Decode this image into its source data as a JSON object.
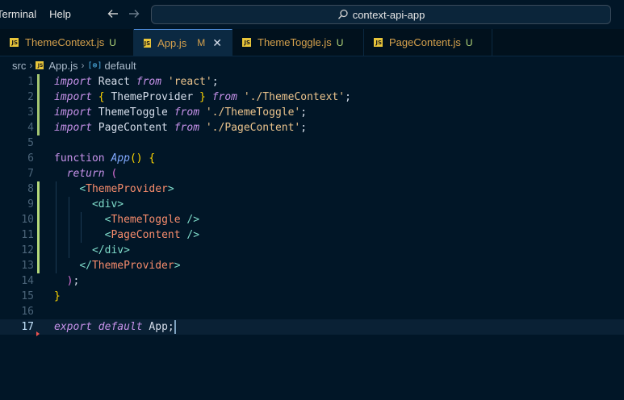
{
  "menu": {
    "terminal": "Terminal",
    "help": "Help"
  },
  "search": {
    "placeholder": "context-api-app"
  },
  "tabs": [
    {
      "name": "ThemeContext.js",
      "status": "U"
    },
    {
      "name": "App.js",
      "status": "M"
    },
    {
      "name": "ThemeToggle.js",
      "status": "U"
    },
    {
      "name": "PageContent.js",
      "status": "U"
    }
  ],
  "breadcrumb": {
    "folder": "src",
    "file": "App.js",
    "symbol": "default"
  },
  "icons": {
    "back": "arrow-left-icon",
    "forward": "arrow-right-icon",
    "search": "search-icon",
    "close": "close-icon",
    "js_file": "js-file-icon",
    "symbol": "symbol-variable-icon"
  },
  "colors": {
    "background": "#011627",
    "tab_active_bg": "#0b2942",
    "untracked": "#b5d97b",
    "modified": "#d4a04c",
    "keyword": "#c792ea",
    "string": "#ecc48d",
    "function": "#82aaff",
    "tag": "#7fdbca",
    "component": "#f78c6c"
  },
  "editor": {
    "active_line": 17,
    "lines": [
      {
        "n": "1",
        "marker": "mod",
        "indent": 0,
        "tokens": [
          [
            "kw",
            "import"
          ],
          [
            "plain",
            " React "
          ],
          [
            "kw",
            "from"
          ],
          [
            "plain",
            " "
          ],
          [
            "str",
            "'react'"
          ],
          [
            "plain",
            ";"
          ]
        ]
      },
      {
        "n": "2",
        "marker": "mod",
        "indent": 0,
        "tokens": [
          [
            "kw",
            "import"
          ],
          [
            "plain",
            " "
          ],
          [
            "pn",
            "{"
          ],
          [
            "plain",
            " ThemeProvider "
          ],
          [
            "pn",
            "}"
          ],
          [
            "plain",
            " "
          ],
          [
            "kw",
            "from"
          ],
          [
            "plain",
            " "
          ],
          [
            "str",
            "'./ThemeContext'"
          ],
          [
            "plain",
            ";"
          ]
        ]
      },
      {
        "n": "3",
        "marker": "mod",
        "indent": 0,
        "tokens": [
          [
            "kw",
            "import"
          ],
          [
            "plain",
            " ThemeToggle "
          ],
          [
            "kw",
            "from"
          ],
          [
            "plain",
            " "
          ],
          [
            "str",
            "'./ThemeToggle'"
          ],
          [
            "plain",
            ";"
          ]
        ]
      },
      {
        "n": "4",
        "marker": "mod",
        "indent": 0,
        "tokens": [
          [
            "kw",
            "import"
          ],
          [
            "plain",
            " PageContent "
          ],
          [
            "kw",
            "from"
          ],
          [
            "plain",
            " "
          ],
          [
            "str",
            "'./PageContent'"
          ],
          [
            "plain",
            ";"
          ]
        ]
      },
      {
        "n": "5",
        "marker": "",
        "indent": 0,
        "tokens": []
      },
      {
        "n": "6",
        "marker": "",
        "indent": 0,
        "tokens": [
          [
            "kwn",
            "function"
          ],
          [
            "plain",
            " "
          ],
          [
            "fn",
            "App"
          ],
          [
            "pn",
            "()"
          ],
          [
            "plain",
            " "
          ],
          [
            "pn",
            "{"
          ]
        ]
      },
      {
        "n": "7",
        "marker": "",
        "indent": 1,
        "tokens": [
          [
            "kw",
            "return"
          ],
          [
            "plain",
            " "
          ],
          [
            "pp",
            "("
          ]
        ]
      },
      {
        "n": "8",
        "marker": "add",
        "indent": 2,
        "tokens": [
          [
            "tag",
            "<"
          ],
          [
            "comp",
            "ThemeProvider"
          ],
          [
            "tag",
            ">"
          ]
        ]
      },
      {
        "n": "9",
        "marker": "add",
        "indent": 3,
        "tokens": [
          [
            "tag",
            "<div>"
          ]
        ]
      },
      {
        "n": "10",
        "marker": "add",
        "indent": 4,
        "tokens": [
          [
            "tag",
            "<"
          ],
          [
            "comp",
            "ThemeToggle"
          ],
          [
            "tag",
            " />"
          ]
        ]
      },
      {
        "n": "11",
        "marker": "add",
        "indent": 4,
        "tokens": [
          [
            "tag",
            "<"
          ],
          [
            "comp",
            "PageContent"
          ],
          [
            "tag",
            " />"
          ]
        ]
      },
      {
        "n": "12",
        "marker": "add",
        "indent": 3,
        "tokens": [
          [
            "tag",
            "</div>"
          ]
        ]
      },
      {
        "n": "13",
        "marker": "add",
        "indent": 2,
        "tokens": [
          [
            "tag",
            "</"
          ],
          [
            "comp",
            "ThemeProvider"
          ],
          [
            "tag",
            ">"
          ]
        ]
      },
      {
        "n": "14",
        "marker": "",
        "indent": 1,
        "tokens": [
          [
            "pp",
            ")"
          ],
          [
            "plain",
            ";"
          ]
        ]
      },
      {
        "n": "15",
        "marker": "",
        "indent": 0,
        "tokens": [
          [
            "pn",
            "}"
          ]
        ]
      },
      {
        "n": "16",
        "marker": "",
        "indent": 0,
        "tokens": []
      },
      {
        "n": "17",
        "marker": "del",
        "indent": 0,
        "tokens": [
          [
            "kw",
            "export"
          ],
          [
            "plain",
            " "
          ],
          [
            "kw",
            "default"
          ],
          [
            "plain",
            " App;"
          ]
        ]
      }
    ]
  }
}
